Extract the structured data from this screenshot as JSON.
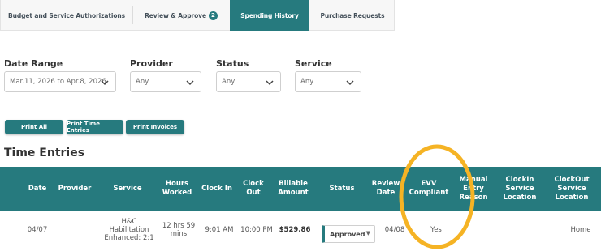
{
  "tabs": [
    {
      "label": "Budget and Service Authorizations",
      "active": false
    },
    {
      "label": "Review & Approve",
      "badge": "2",
      "active": false
    },
    {
      "label": "Spending History",
      "active": true
    },
    {
      "label": "Purchase Requests",
      "active": false
    }
  ],
  "filters": {
    "date_range": {
      "label": "Date Range",
      "value": "Mar.11, 2026 to Apr.8, 2026"
    },
    "provider": {
      "label": "Provider",
      "value": "Any"
    },
    "status": {
      "label": "Status",
      "value": "Any"
    },
    "service": {
      "label": "Service",
      "value": "Any"
    }
  },
  "buttons": {
    "print_all": "Print All",
    "print_time_entries": "Print Time Entries",
    "print_invoices": "Print Invoices"
  },
  "section_title": "Time Entries",
  "table": {
    "headers": {
      "date": "Date",
      "provider": "Provider",
      "service": "Service",
      "hours_worked": "Hours\nWorked",
      "clock_in": "Clock In",
      "clock_out": "Clock\nOut",
      "billable_amount": "Billable\nAmount",
      "status": "Status",
      "review_date": "Review\nDate",
      "evv_compliant": "EVV\nCompliant",
      "manual_entry_reason": "Manual\nEntry\nReason",
      "clockin_service_location": "ClockIn\nService\nLocation",
      "clockout_service_location": "ClockOut\nService\nLocation"
    },
    "rows": [
      {
        "date": "04/07",
        "provider": "",
        "service": "H&C\nHabilitation\nEnhanced: 2:1",
        "hours_worked": "12 hrs 59\nmins",
        "clock_in": "9:01 AM",
        "clock_out": "10:00 PM",
        "billable_amount": "$529.86",
        "status": "Approved",
        "review_date": "04/08",
        "evv_compliant": "Yes",
        "manual_entry_reason": "",
        "clockin_service_location": "",
        "clockout_service_location": "Home"
      }
    ]
  },
  "colors": {
    "accent": "#267a7e",
    "highlight": "#f5b324"
  }
}
